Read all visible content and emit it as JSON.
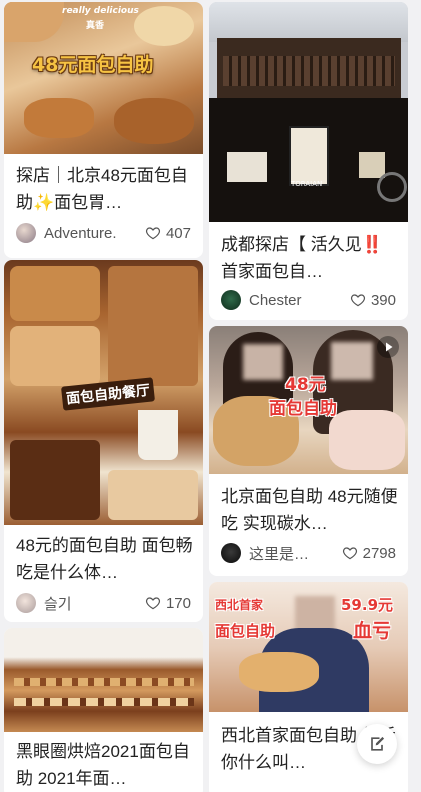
{
  "cards": [
    {
      "title": "探店｜北京48元面包自助✨面包胃…",
      "author": "Adventure.",
      "likes": "407",
      "cover_text": "48元面包自助",
      "cover_small_text": "really delicious",
      "cover_tag": "真香"
    },
    {
      "title": "成都探店【 活久见‼️首家面包自…",
      "author": "Chester",
      "likes": "390",
      "cover_text": "TORAIAN"
    },
    {
      "title": "48元的面包自助 面包畅吃是什么体…",
      "author": "슬기",
      "likes": "170",
      "cover_text": "面包自助餐厅"
    },
    {
      "title": "北京面包自助 48元随便吃 实现碳水…",
      "author": "这里是…",
      "likes": "2798",
      "cover_text_line1": "48元",
      "cover_text_line2": "面包自助"
    },
    {
      "title": "黑眼圈烘焙2021面包自助 2021年面…",
      "author": "",
      "likes": ""
    },
    {
      "title": "西北首家面包自助 告诉你什么叫…",
      "author": "",
      "likes": "",
      "cover_text_left1": "西北首家",
      "cover_text_left2": "面包自助",
      "cover_price": "59.9元",
      "cover_text_right": "血亏"
    }
  ],
  "colors": {
    "accent_red": "#e53935",
    "gold": "#f6c343",
    "like_stroke": "#555555"
  },
  "icons": {
    "like": "heart-outline-icon",
    "compose": "edit-note-icon",
    "video": "play-icon"
  }
}
